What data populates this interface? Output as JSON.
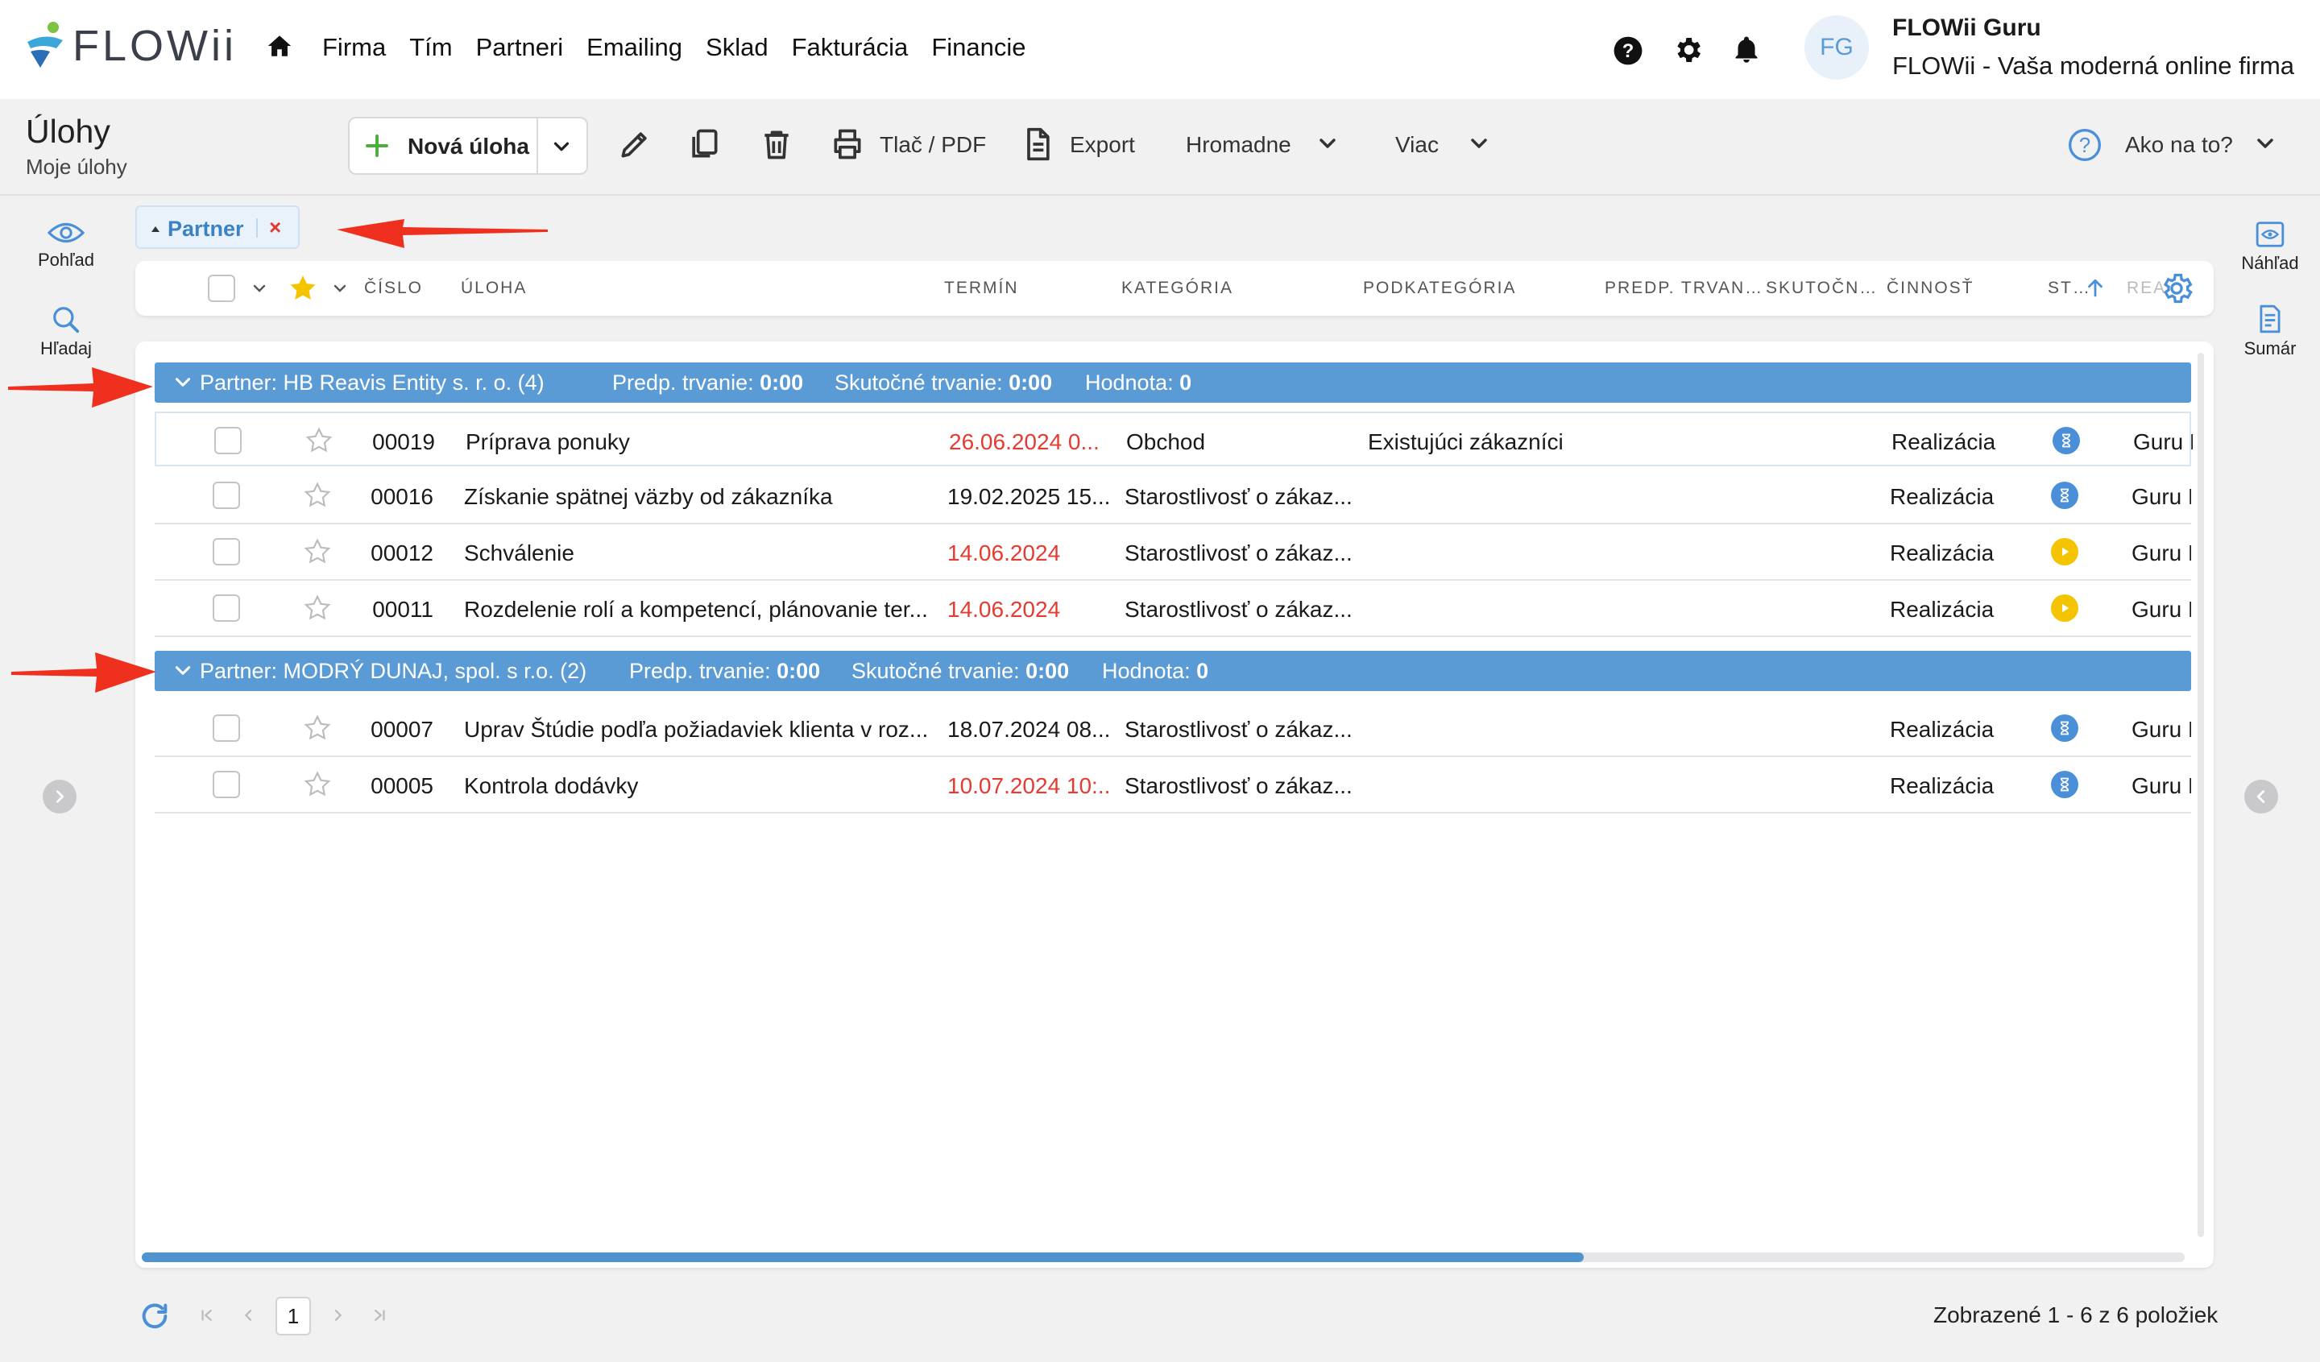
{
  "app": {
    "logo_text": "FLOWii",
    "nav": [
      "Firma",
      "Tím",
      "Partneri",
      "Emailing",
      "Sklad",
      "Fakturácia",
      "Financie"
    ],
    "user": {
      "initials": "FG",
      "name": "FLOWii Guru",
      "company": "FLOWii - Vaša moderná online firma"
    }
  },
  "page": {
    "title": "Úlohy",
    "subtitle": "Moje úlohy"
  },
  "toolbar": {
    "new_task": "Nová úloha",
    "print": "Tlač / PDF",
    "export": "Export",
    "bulk": "Hromadne",
    "more": "Viac",
    "help": "Ako na to?"
  },
  "left_rail": {
    "view": "Pohľad",
    "search": "Hľadaj"
  },
  "right_rail": {
    "preview": "Náhľad",
    "summary": "Sumár"
  },
  "filter_chip": {
    "label": "Partner"
  },
  "columns": {
    "number": "ČÍSLO",
    "task": "ÚLOHA",
    "term": "TERMÍN",
    "category": "KATEGÓRIA",
    "subcategory": "PODKATEGÓRIA",
    "est_duration": "PREDP. TRVAN…",
    "actual": "SKUTOČN…",
    "activity": "ČINNOSŤ",
    "status": "ST…",
    "rea": "REA"
  },
  "groups": [
    {
      "label": "Partner: HB Reavis Entity s. r. o. (4)",
      "est_label": "Predp. trvanie:",
      "est_value": "0:00",
      "actual_label": "Skutočné trvanie:",
      "actual_value": "0:00",
      "value_label": "Hodnota:",
      "value_value": "0",
      "rows": [
        {
          "number": "00019",
          "task": "Príprava ponuky",
          "term": "26.06.2024 0...",
          "term_overdue": true,
          "category": "Obchod",
          "subcategory": "Existujúci zákazníci",
          "activity": "Realizácia",
          "status": "waiting",
          "rea": "Guru F"
        },
        {
          "number": "00016",
          "task": "Získanie spätnej väzby od zákazníka",
          "term": "19.02.2025 15...",
          "term_overdue": false,
          "category": "Starostlivosť o zákaz...",
          "subcategory": "",
          "activity": "Realizácia",
          "status": "waiting",
          "rea": "Guru F"
        },
        {
          "number": "00012",
          "task": "Schválenie",
          "term": "14.06.2024",
          "term_overdue": true,
          "category": "Starostlivosť o zákaz...",
          "subcategory": "",
          "activity": "Realizácia",
          "status": "in-progress",
          "rea": "Guru F"
        },
        {
          "number": "00011",
          "task": "Rozdelenie rolí a kompetencí, plánovanie ter...",
          "term": "14.06.2024",
          "term_overdue": true,
          "category": "Starostlivosť o zákaz...",
          "subcategory": "",
          "activity": "Realizácia",
          "status": "in-progress",
          "rea": "Guru F"
        }
      ]
    },
    {
      "label": "Partner: MODRÝ DUNAJ, spol. s r.o. (2)",
      "est_label": "Predp. trvanie:",
      "est_value": "0:00",
      "actual_label": "Skutočné trvanie:",
      "actual_value": "0:00",
      "value_label": "Hodnota:",
      "value_value": "0",
      "rows": [
        {
          "number": "00007",
          "task": "Uprav Štúdie podľa požiadaviek klienta v roz...",
          "term": "18.07.2024 08...",
          "term_overdue": false,
          "category": "Starostlivosť o zákaz...",
          "subcategory": "",
          "activity": "Realizácia",
          "status": "waiting",
          "rea": "Guru F"
        },
        {
          "number": "00005",
          "task": "Kontrola dodávky",
          "term": "10.07.2024 10:...",
          "term_overdue": true,
          "category": "Starostlivosť o zákaz...",
          "subcategory": "",
          "activity": "Realizácia",
          "status": "waiting",
          "rea": "Guru F"
        }
      ]
    }
  ],
  "pager": {
    "current_page": "1",
    "summary": "Zobrazené 1 - 6 z 6 položiek"
  },
  "colors": {
    "accent": "#5b9bd5",
    "overdue": "#e53b31",
    "waiting": "#4a8fd8",
    "in_progress": "#f5c400",
    "annotation_arrow": "#f0301f"
  }
}
